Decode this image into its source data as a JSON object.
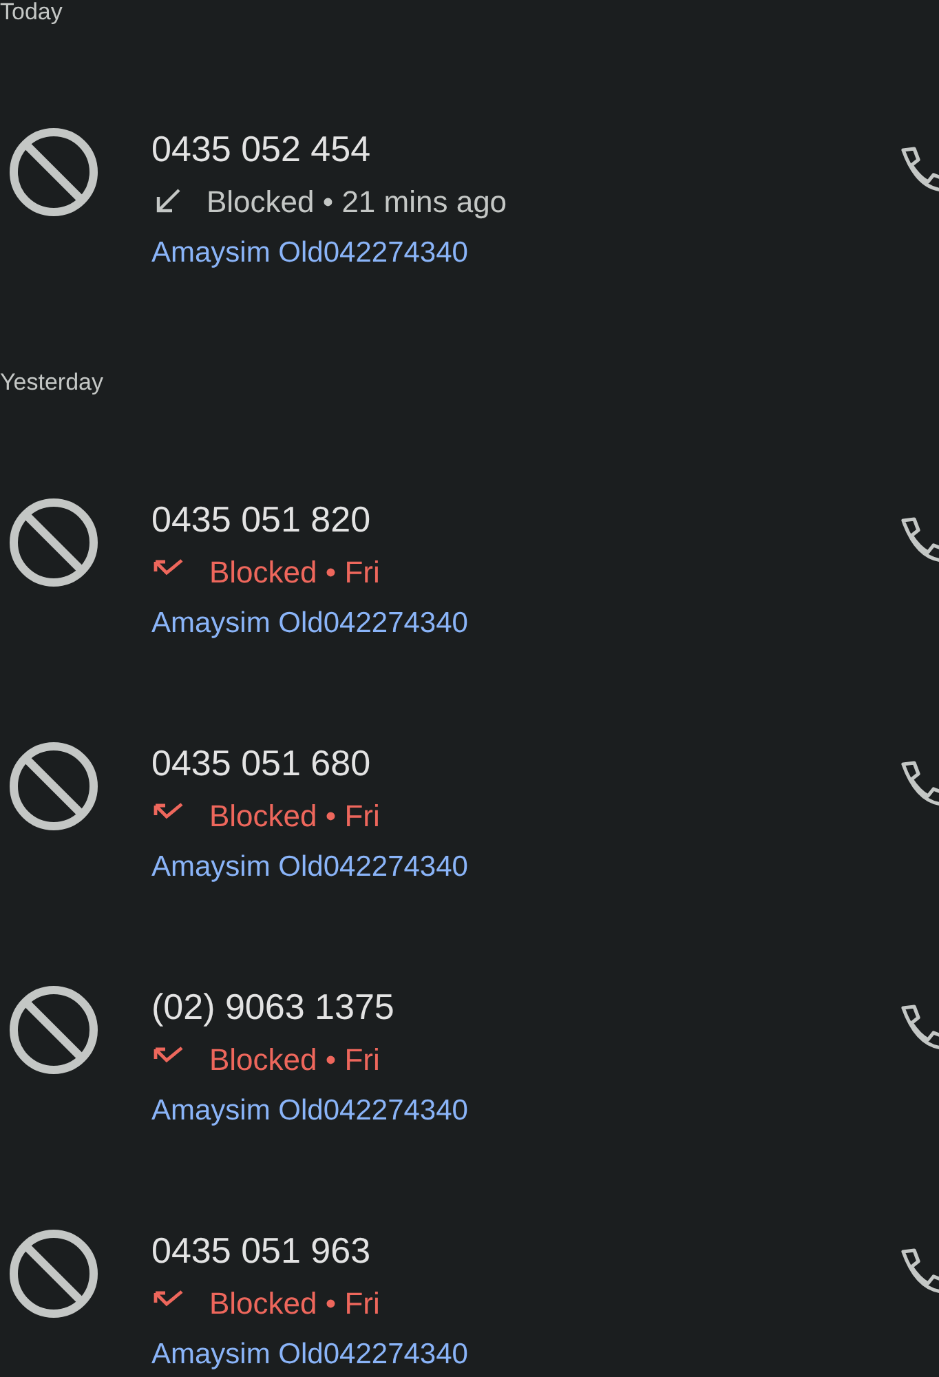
{
  "sections": [
    {
      "label": "Today",
      "calls": [
        {
          "number": "0435 052 454",
          "kind": "incoming",
          "status": "Blocked • 21 mins ago",
          "account": "Amaysim Old042274340"
        }
      ]
    },
    {
      "label": "Yesterday",
      "calls": [
        {
          "number": "0435 051 820",
          "kind": "missed",
          "status": "Blocked • Fri",
          "account": "Amaysim Old042274340"
        },
        {
          "number": "0435 051 680",
          "kind": "missed",
          "status": "Blocked • Fri",
          "account": "Amaysim Old042274340"
        },
        {
          "number": "(02) 9063 1375",
          "kind": "missed",
          "status": "Blocked • Fri",
          "account": "Amaysim Old042274340"
        },
        {
          "number": "0435 051 963",
          "kind": "missed",
          "status": "Blocked • Fri",
          "account": "Amaysim Old042274340"
        }
      ]
    }
  ]
}
